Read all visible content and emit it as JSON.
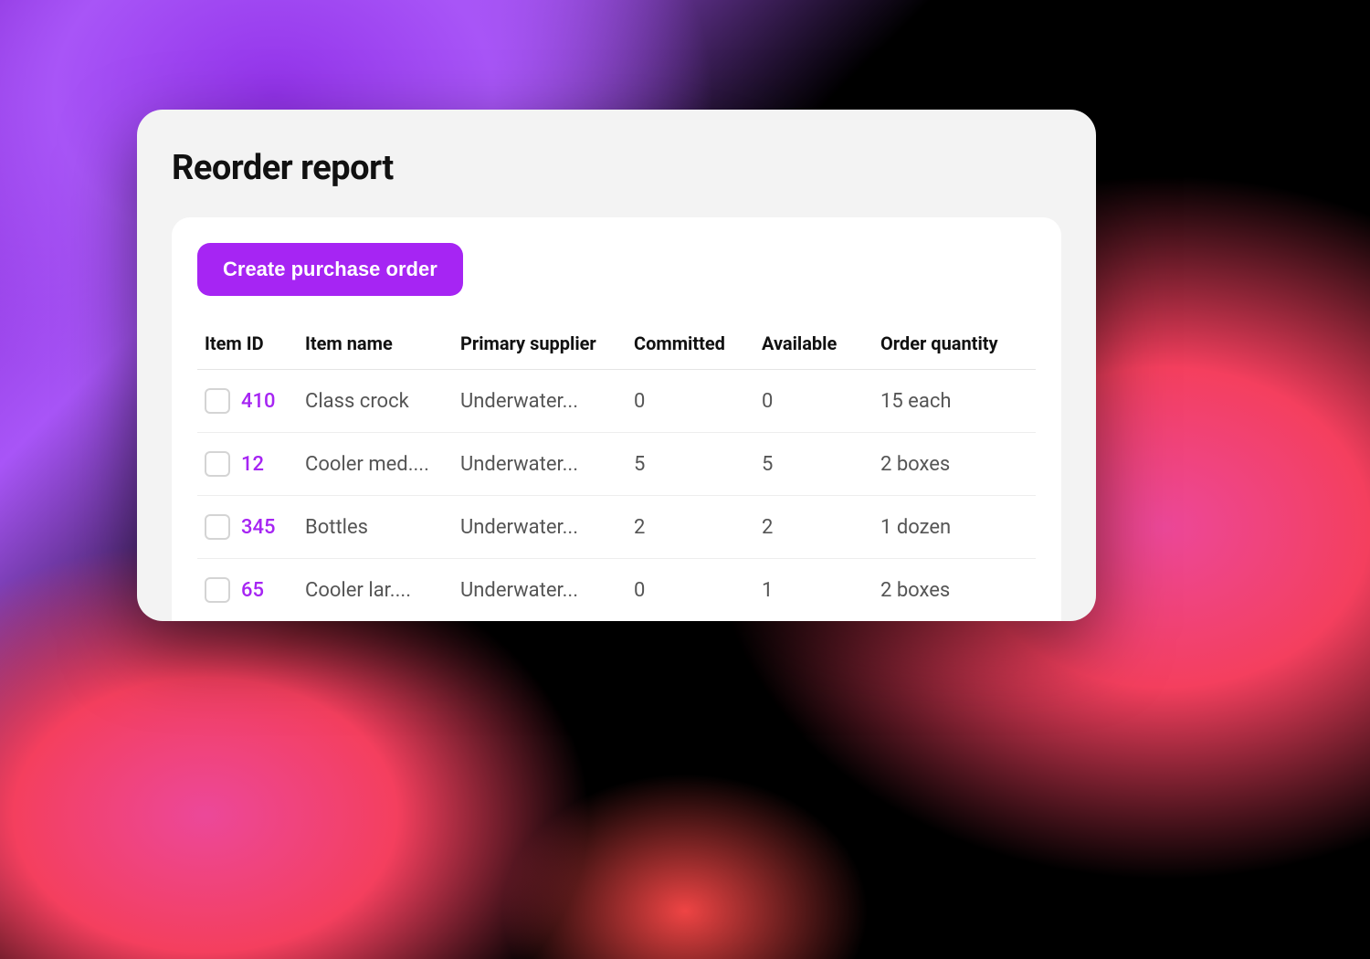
{
  "page_title": "Reorder report",
  "create_button_label": "Create purchase order",
  "table": {
    "headers": {
      "item_id": "Item ID",
      "item_name": "Item name",
      "primary_supplier": "Primary supplier",
      "committed": "Committed",
      "available": "Available",
      "order_quantity": "Order quantity"
    },
    "rows": [
      {
        "item_id": "410",
        "item_name": "Class crock",
        "primary_supplier": "Underwater...",
        "committed": "0",
        "available": "0",
        "order_quantity": "15 each"
      },
      {
        "item_id": "12",
        "item_name": "Cooler med....",
        "primary_supplier": "Underwater...",
        "committed": "5",
        "available": "5",
        "order_quantity": "2 boxes"
      },
      {
        "item_id": "345",
        "item_name": "Bottles",
        "primary_supplier": "Underwater...",
        "committed": "2",
        "available": "2",
        "order_quantity": "1 dozen"
      },
      {
        "item_id": "65",
        "item_name": "Cooler lar....",
        "primary_supplier": "Underwater...",
        "committed": "0",
        "available": "1",
        "order_quantity": "2 boxes"
      }
    ]
  },
  "colors": {
    "accent": "#a625f3"
  }
}
